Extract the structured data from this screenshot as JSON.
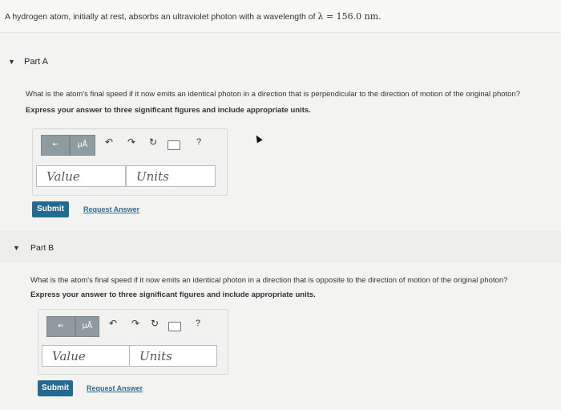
{
  "problem": {
    "prefix": "A hydrogen atom, initially at rest, absorbs an ultraviolet photon with a wavelength of",
    "math": "λ = 156.0 nm."
  },
  "parts": [
    {
      "title": "Part A",
      "question": "What is the atom's final speed if it now emits an identical photon in a direction that is perpendicular to the direction of motion of the original photon?",
      "instruction": "Express your answer to three significant figures and include appropriate units.",
      "toolbar": {
        "templates_label": "▪▫",
        "greek_label": "μÅ",
        "help_label": "?"
      },
      "value_placeholder": "Value",
      "units_placeholder": "Units",
      "submit_label": "Submit",
      "request_label": "Request Answer"
    },
    {
      "title": "Part B",
      "question": "What is the atom's final speed if it now emits an identical photon in a direction that is opposite to the direction of motion of the original photon?",
      "instruction": "Express your answer to three significant figures and include appropriate units.",
      "toolbar": {
        "templates_label": "▪▫",
        "greek_label": "μÅ",
        "help_label": "?"
      },
      "value_placeholder": "Value",
      "units_placeholder": "Units",
      "submit_label": "Submit",
      "request_label": "Request Answer"
    }
  ],
  "icons": {
    "collapse": "caret-down-icon",
    "undo": "undo-icon",
    "redo": "redo-icon",
    "reset": "reset-icon",
    "keyboard": "keyboard-icon",
    "help": "help-icon"
  }
}
